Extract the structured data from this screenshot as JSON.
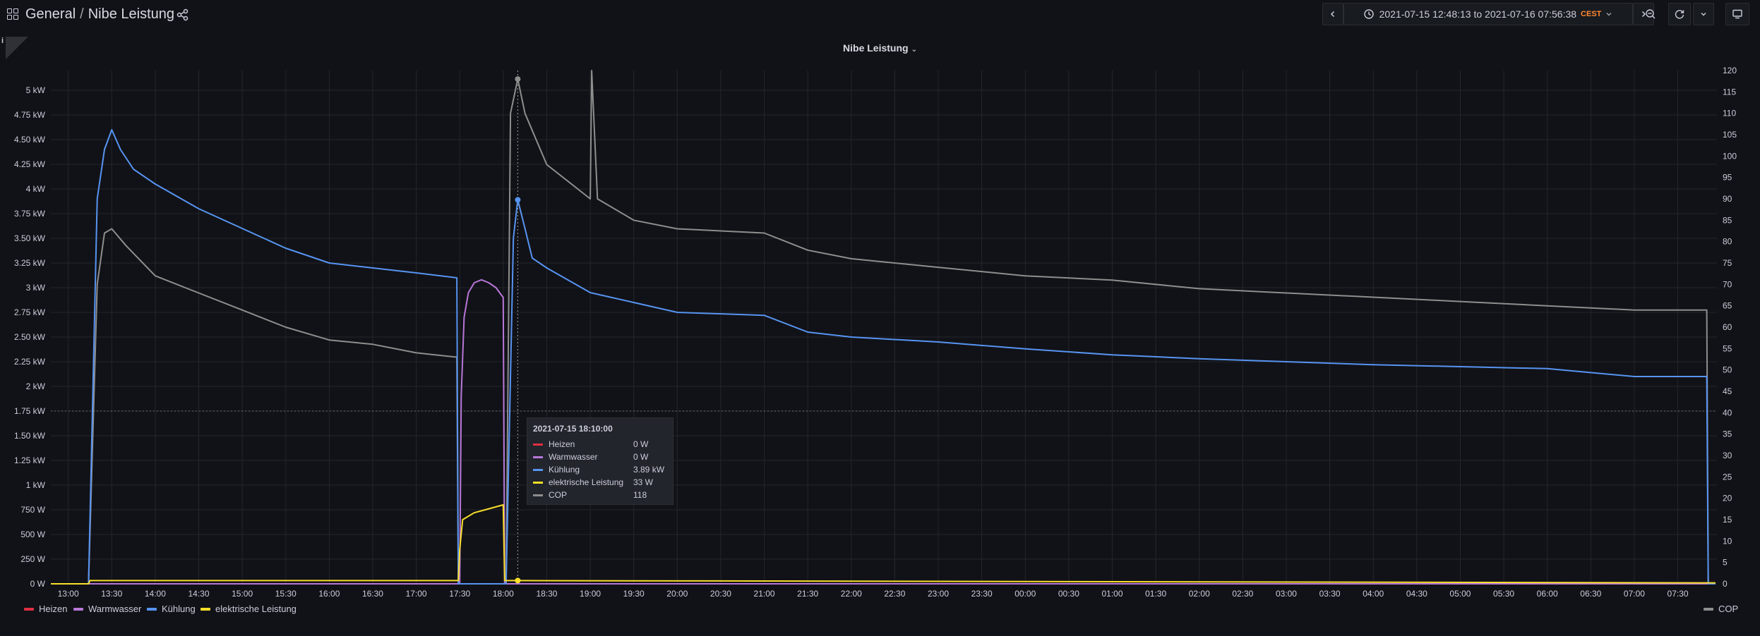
{
  "breadcrumb": {
    "folder": "General",
    "separator": "/",
    "dashboard": "Nibe Leistung"
  },
  "toolbar": {
    "time_range": "2021-07-15 12:48:13 to 2021-07-16 07:56:38",
    "timezone": "CEST"
  },
  "panel": {
    "info_label": "i",
    "title": "Nibe Leistung"
  },
  "colors": {
    "Heizen": "#e02f44",
    "Warmwasser": "#b877d9",
    "Kühlung": "#5794f2",
    "elektrische Leistung": "#fade2a",
    "COP": "#8e8e8e"
  },
  "chart_data": {
    "type": "line",
    "x_ticks": [
      "13:00",
      "13:30",
      "14:00",
      "14:30",
      "15:00",
      "15:30",
      "16:00",
      "16:30",
      "17:00",
      "17:30",
      "18:00",
      "18:30",
      "19:00",
      "19:30",
      "20:00",
      "20:30",
      "21:00",
      "21:30",
      "22:00",
      "22:30",
      "23:00",
      "23:30",
      "00:00",
      "00:30",
      "01:00",
      "01:30",
      "02:00",
      "02:30",
      "03:00",
      "03:30",
      "04:00",
      "04:30",
      "05:00",
      "05:30",
      "06:00",
      "06:30",
      "07:00",
      "07:30"
    ],
    "y_left_ticks": [
      "0 W",
      "250 W",
      "500 W",
      "750 W",
      "1 kW",
      "1.25 kW",
      "1.50 kW",
      "1.75 kW",
      "2 kW",
      "2.25 kW",
      "2.50 kW",
      "2.75 kW",
      "3 kW",
      "3.25 kW",
      "3.50 kW",
      "3.75 kW",
      "4 kW",
      "4.25 kW",
      "4.50 kW",
      "4.75 kW",
      "5 kW"
    ],
    "y_right_ticks": [
      "0",
      "5",
      "10",
      "15",
      "20",
      "25",
      "30",
      "35",
      "40",
      "45",
      "50",
      "55",
      "60",
      "65",
      "70",
      "75",
      "80",
      "85",
      "90",
      "95",
      "100",
      "105",
      "110",
      "115",
      "120"
    ],
    "y_left_range_kw": [
      0,
      5.2
    ],
    "y_right_range": [
      0,
      120
    ],
    "series": [
      {
        "name": "Heizen",
        "axis": "left",
        "unit": "kW",
        "x": [
          "12:48",
          "07:56"
        ],
        "y": [
          0,
          0
        ]
      },
      {
        "name": "Warmwasser",
        "axis": "left",
        "unit": "kW",
        "x": [
          "12:48",
          "17:30",
          "17:31",
          "17:33",
          "17:36",
          "17:40",
          "17:45",
          "17:50",
          "17:55",
          "18:00",
          "18:01",
          "07:56"
        ],
        "y": [
          0,
          0,
          1.9,
          2.7,
          2.95,
          3.05,
          3.08,
          3.05,
          3.0,
          2.9,
          0,
          0
        ]
      },
      {
        "name": "Kühlung",
        "axis": "left",
        "unit": "kW",
        "x": [
          "12:48",
          "13:14",
          "13:20",
          "13:25",
          "13:30",
          "13:36",
          "13:45",
          "14:00",
          "14:30",
          "15:00",
          "15:30",
          "16:00",
          "16:30",
          "17:00",
          "17:28",
          "17:29",
          "18:02",
          "18:07",
          "18:10",
          "18:15",
          "18:20",
          "18:30",
          "19:00",
          "19:30",
          "20:00",
          "21:00",
          "21:30",
          "22:00",
          "23:00",
          "00:00",
          "01:00",
          "02:00",
          "03:00",
          "04:00",
          "05:00",
          "06:00",
          "07:00",
          "07:50",
          "07:51",
          "07:56"
        ],
        "y": [
          0,
          0,
          3.9,
          4.4,
          4.6,
          4.4,
          4.2,
          4.05,
          3.8,
          3.6,
          3.4,
          3.25,
          3.2,
          3.15,
          3.1,
          0,
          0,
          3.5,
          3.89,
          3.6,
          3.3,
          3.2,
          2.95,
          2.85,
          2.75,
          2.72,
          2.55,
          2.5,
          2.45,
          2.38,
          2.32,
          2.28,
          2.25,
          2.22,
          2.2,
          2.18,
          2.1,
          2.1,
          0,
          0
        ]
      },
      {
        "name": "elektrische Leistung",
        "axis": "left",
        "unit": "kW",
        "x": [
          "12:48",
          "13:14",
          "13:15",
          "17:29",
          "17:30",
          "17:32",
          "17:40",
          "17:50",
          "18:00",
          "18:01",
          "18:10",
          "07:56"
        ],
        "y": [
          0,
          0,
          0.033,
          0.033,
          0.35,
          0.65,
          0.72,
          0.76,
          0.8,
          0.033,
          0.033,
          0.01
        ]
      },
      {
        "name": "COP",
        "axis": "right",
        "unit": "",
        "x": [
          "12:48",
          "13:14",
          "13:20",
          "13:25",
          "13:30",
          "13:40",
          "14:00",
          "14:30",
          "15:00",
          "15:30",
          "16:00",
          "16:30",
          "17:00",
          "17:28",
          "17:29",
          "18:02",
          "18:05",
          "18:10",
          "18:15",
          "18:30",
          "18:45",
          "19:00",
          "19:01",
          "19:05",
          "19:30",
          "20:00",
          "21:00",
          "21:30",
          "22:00",
          "23:00",
          "00:00",
          "01:00",
          "02:00",
          "03:00",
          "04:00",
          "05:00",
          "06:00",
          "07:00",
          "07:50",
          "07:51",
          "07:56"
        ],
        "y": [
          0,
          0,
          70,
          82,
          83,
          79,
          72,
          68,
          64,
          60,
          57,
          56,
          54,
          53,
          0,
          0,
          110,
          118,
          110,
          98,
          94,
          90,
          120,
          90,
          85,
          83,
          82,
          78,
          76,
          74,
          72,
          71,
          69,
          68,
          67,
          66,
          65,
          64,
          64,
          0,
          0
        ]
      }
    ],
    "hover": {
      "time": "2021-07-15 18:10:00",
      "values": [
        {
          "name": "Heizen",
          "value": "0 W"
        },
        {
          "name": "Warmwasser",
          "value": "0 W"
        },
        {
          "name": "Kühlung",
          "value": "3.89 kW"
        },
        {
          "name": "elektrische Leistung",
          "value": "33 W"
        },
        {
          "name": "COP",
          "value": "118"
        }
      ]
    },
    "legend_left": [
      "Heizen",
      "Warmwasser",
      "Kühlung",
      "elektrische Leistung"
    ],
    "legend_right": [
      "COP"
    ],
    "grid": true
  }
}
